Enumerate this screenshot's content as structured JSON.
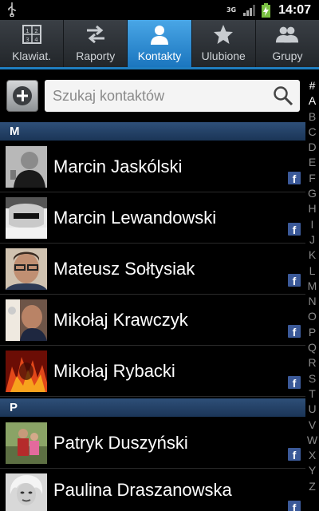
{
  "status": {
    "network": "3G",
    "time": "14:07"
  },
  "tabs": [
    {
      "label": "Klawiat.",
      "icon": "keypad-icon",
      "active": false
    },
    {
      "label": "Raporty",
      "icon": "call-log-icon",
      "active": false
    },
    {
      "label": "Kontakty",
      "icon": "contact-person-icon",
      "active": true
    },
    {
      "label": "Ulubione",
      "icon": "star-icon",
      "active": false
    },
    {
      "label": "Grupy",
      "icon": "groups-icon",
      "active": false
    }
  ],
  "search": {
    "placeholder": "Szukaj kontaktów"
  },
  "sections": [
    {
      "letter": "M",
      "contacts": [
        {
          "name": "Marcin Jaskólski",
          "badge": "f"
        },
        {
          "name": "Marcin Lewandowski",
          "badge": "f"
        },
        {
          "name": "Mateusz Sołtysiak",
          "badge": "f"
        },
        {
          "name": "Mikołaj Krawczyk",
          "badge": "f"
        },
        {
          "name": "Mikołaj Rybacki",
          "badge": "f"
        }
      ]
    },
    {
      "letter": "P",
      "contacts": [
        {
          "name": "Patryk Duszyński",
          "badge": "f"
        },
        {
          "name": "Paulina Draszanowska",
          "badge": "f"
        }
      ]
    }
  ],
  "alphabet": [
    "#",
    "A",
    "B",
    "C",
    "D",
    "E",
    "F",
    "G",
    "H",
    "I",
    "J",
    "K",
    "L",
    "M",
    "N",
    "O",
    "P",
    "Q",
    "R",
    "S",
    "T",
    "U",
    "V",
    "W",
    "X",
    "Y",
    "Z"
  ],
  "colors": {
    "accent": "#1f7ec0",
    "section": "#1b3557",
    "facebook": "#3b5998"
  }
}
